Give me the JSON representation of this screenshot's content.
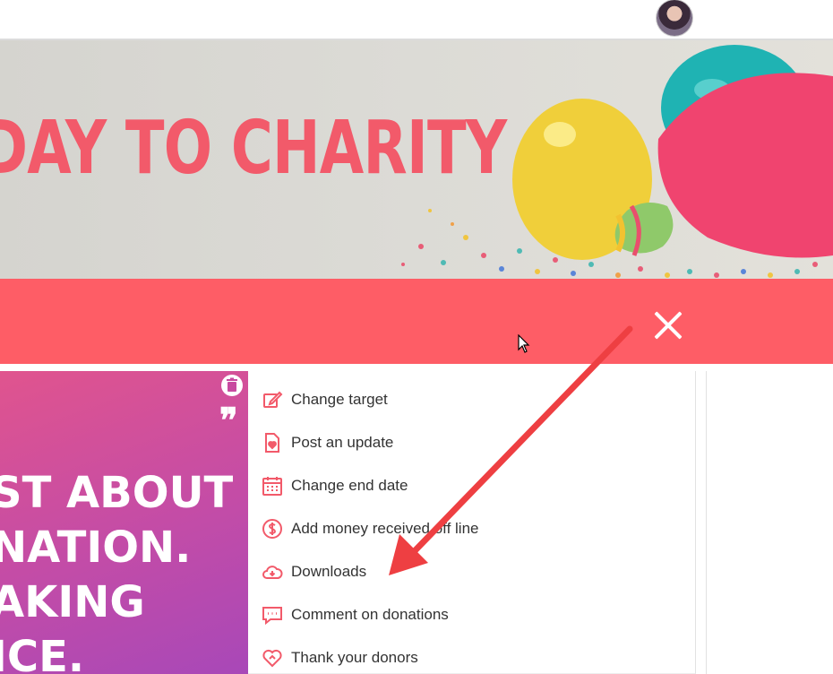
{
  "header": {
    "avatar_name": "avatar"
  },
  "banner": {
    "title": "DAY TO CHARITY"
  },
  "card": {
    "lines": [
      "ST ABOUT",
      "NATION.",
      "AKING",
      "ICE."
    ]
  },
  "menu": {
    "items": [
      {
        "label": "Change target",
        "icon": "edit-icon"
      },
      {
        "label": "Post an update",
        "icon": "document-heart-icon"
      },
      {
        "label": "Change end date",
        "icon": "calendar-icon"
      },
      {
        "label": "Add money received off line",
        "icon": "dollar-circle-icon"
      },
      {
        "label": "Downloads",
        "icon": "cloud-download-icon"
      },
      {
        "label": "Comment on donations",
        "icon": "comment-icon"
      },
      {
        "label": "Thank your donors",
        "icon": "heart-icon"
      }
    ]
  },
  "colors": {
    "accent": "#fe5d66",
    "icon": "#f25a6a",
    "card_start": "#e0548e",
    "card_end": "#a848b8"
  }
}
